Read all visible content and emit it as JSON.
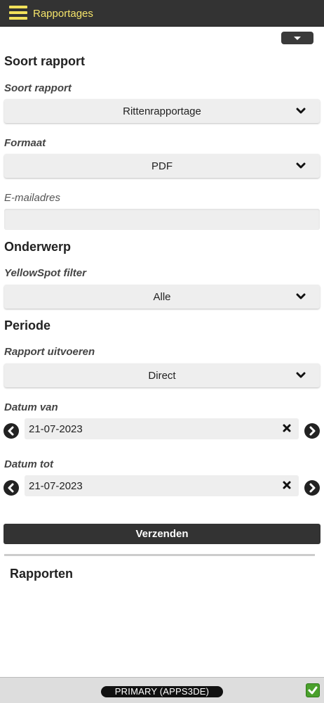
{
  "header": {
    "title": "Rapportages",
    "accent_color": "#f5e46a",
    "menu_icon": "hamburger-icon"
  },
  "sections": {
    "report_type_heading": "Soort rapport",
    "subject_heading": "Onderwerp",
    "period_heading": "Periode",
    "reports_heading": "Rapporten"
  },
  "form": {
    "report_type": {
      "label": "Soort rapport",
      "value": "Rittenrapportage"
    },
    "format": {
      "label": "Formaat",
      "value": "PDF"
    },
    "email": {
      "label": "E-mailadres",
      "value": ""
    },
    "yellowspot_filter": {
      "label": "YellowSpot filter",
      "value": "Alle"
    },
    "run_report": {
      "label": "Rapport uitvoeren",
      "value": "Direct"
    },
    "date_from": {
      "label": "Datum van",
      "value": "21-07-2023"
    },
    "date_to": {
      "label": "Datum tot",
      "value": "21-07-2023"
    },
    "submit_label": "Verzenden"
  },
  "footer": {
    "server_badge": "PRIMARY (APPS3DE)",
    "status_color": "#4aa02c",
    "status_icon": "check-icon"
  }
}
